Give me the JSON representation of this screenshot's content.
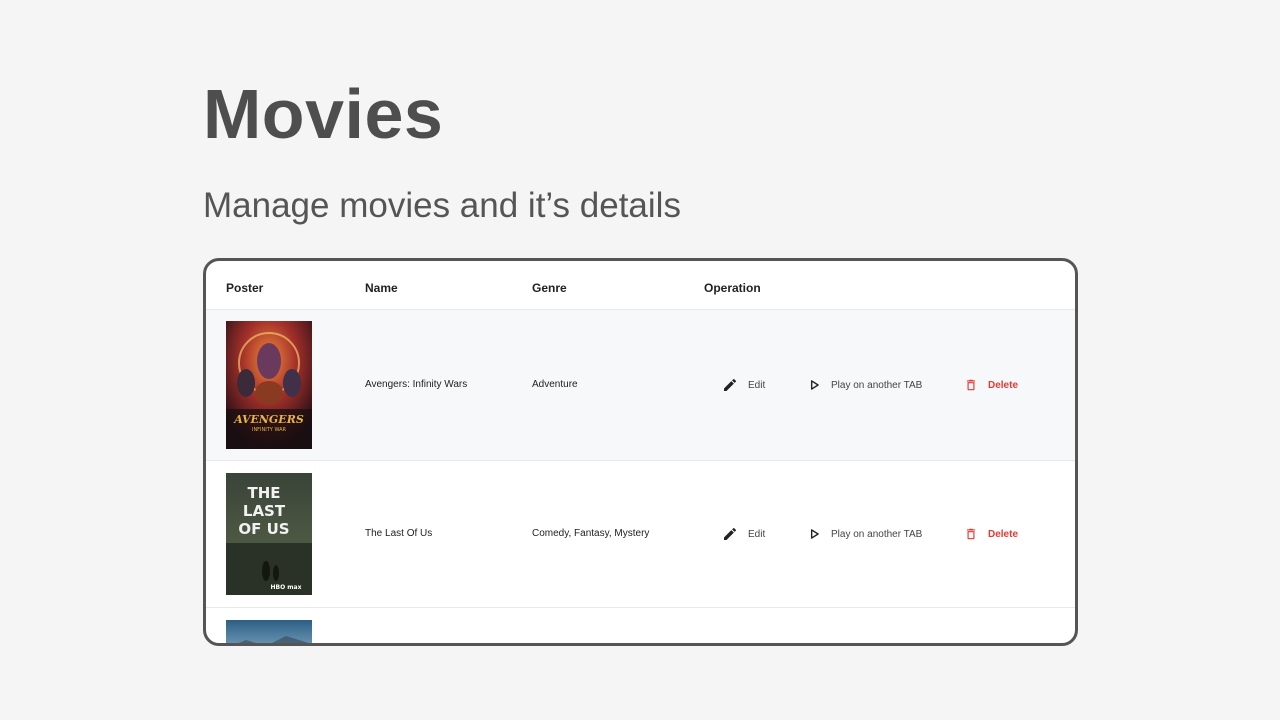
{
  "page": {
    "title": "Movies",
    "subtitle": "Manage movies and it’s details"
  },
  "table": {
    "columns": [
      "Poster",
      "Name",
      "Genre",
      "Operation"
    ],
    "rows": [
      {
        "name": "Avengers: Infinity Wars",
        "genre": "Adventure",
        "poster_text": "AVENGERS",
        "poster_sub": "INFINITY WAR"
      },
      {
        "name": "The Last Of Us",
        "genre": "Comedy, Fantasy, Mystery",
        "poster_text": "THE LAST OF US",
        "poster_sub": "HBO max"
      }
    ],
    "operations": {
      "edit_label": "Edit",
      "play_label": "Play on another TAB",
      "delete_label": "Delete"
    }
  },
  "colors": {
    "delete": "#e53935",
    "border": "#555555",
    "alt_row": "#f7f8fa"
  }
}
